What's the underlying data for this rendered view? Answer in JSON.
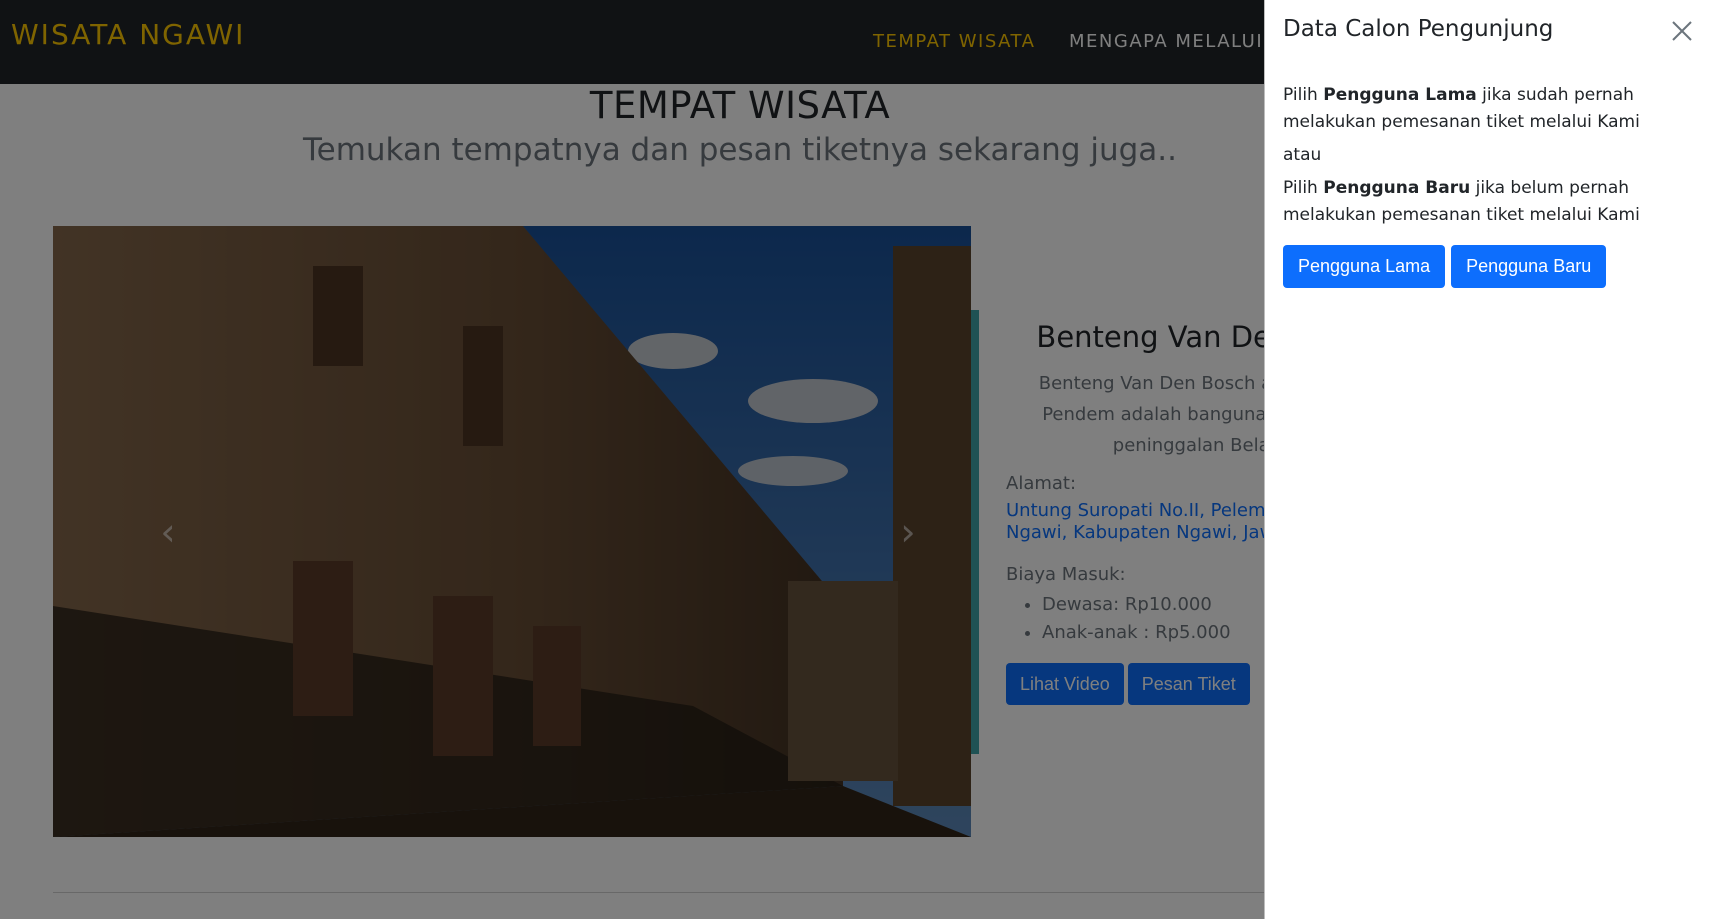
{
  "navbar": {
    "brand": "WISATA NGAWI",
    "links": [
      "TEMPAT WISATA",
      "MENGAPA MELALUI KAMI"
    ]
  },
  "section": {
    "title": "TEMPAT WISATA",
    "subtitle": "Temukan tempatnya dan pesan tiketnya sekarang juga.."
  },
  "place": {
    "name": "Benteng Van Den Bosch",
    "description": "Benteng Van Den Bosch atau Benteng Pendem adalah bangunan bersejarah peninggalan Belanda.",
    "address_label": "Alamat:",
    "address": "Untung Suropati No.II, Pelem II, Pelem, Kec. Ngawi, Kabupaten Ngawi, Jawa Timur",
    "fee_label": "Biaya Masuk:",
    "fees": [
      "Dewasa: Rp10.000",
      "Anak-anak : Rp5.000"
    ],
    "watch_video_label": "Lihat Video",
    "order_ticket_label": "Pesan Tiket"
  },
  "carousel": {
    "prev_icon": "chevron-left-icon",
    "next_icon": "chevron-right-icon"
  },
  "offcanvas": {
    "title": "Data Calon Pengunjung",
    "close_icon": "close-icon",
    "line1_prefix": "Pilih ",
    "line1_strong": "Pengguna Lama",
    "line1_suffix": " jika sudah pernah melakukan pemesanan tiket melalui Kami",
    "or_text": "atau",
    "line2_prefix": "Pilih ",
    "line2_strong": "Pengguna Baru",
    "line2_suffix": " jika belum pernah melakukan pemesanan tiket melalui Kami",
    "old_user_label": "Pengguna Lama",
    "new_user_label": "Pengguna Baru"
  },
  "colors": {
    "brand": "#ffc800",
    "navbar_bg": "#212529",
    "primary": "#0d6efd",
    "accent_bar": "#3fa5a9"
  }
}
